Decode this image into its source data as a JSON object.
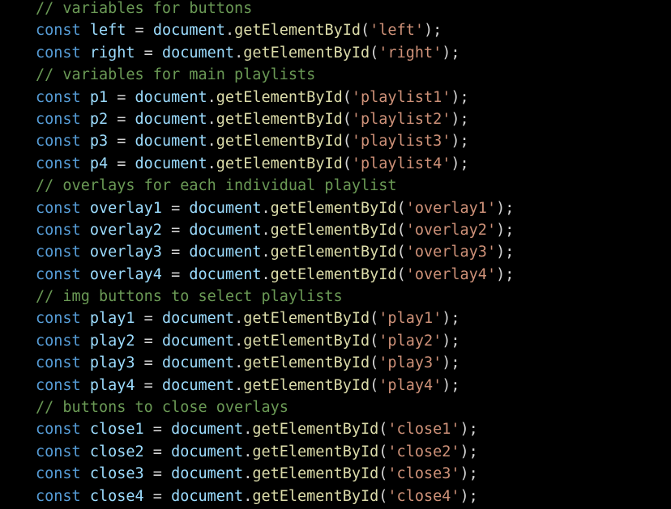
{
  "editor": {
    "lines": [
      {
        "type": "comment",
        "text": "// variables for buttons"
      },
      {
        "type": "code",
        "kw": "const",
        "name": "left",
        "obj": "document",
        "fn": "getElementById",
        "arg": "'left'"
      },
      {
        "type": "code",
        "kw": "const",
        "name": "right",
        "obj": "document",
        "fn": "getElementById",
        "arg": "'right'"
      },
      {
        "type": "comment",
        "text": "// variables for main playlists"
      },
      {
        "type": "code",
        "kw": "const",
        "name": "p1",
        "obj": "document",
        "fn": "getElementById",
        "arg": "'playlist1'"
      },
      {
        "type": "code",
        "kw": "const",
        "name": "p2",
        "obj": "document",
        "fn": "getElementById",
        "arg": "'playlist2'"
      },
      {
        "type": "code",
        "kw": "const",
        "name": "p3",
        "obj": "document",
        "fn": "getElementById",
        "arg": "'playlist3'"
      },
      {
        "type": "code",
        "kw": "const",
        "name": "p4",
        "obj": "document",
        "fn": "getElementById",
        "arg": "'playlist4'"
      },
      {
        "type": "comment",
        "text": "// overlays for each individual playlist"
      },
      {
        "type": "code",
        "kw": "const",
        "name": "overlay1",
        "obj": "document",
        "fn": "getElementById",
        "arg": "'overlay1'"
      },
      {
        "type": "code",
        "kw": "const",
        "name": "overlay2",
        "obj": "document",
        "fn": "getElementById",
        "arg": "'overlay2'"
      },
      {
        "type": "code",
        "kw": "const",
        "name": "overlay3",
        "obj": "document",
        "fn": "getElementById",
        "arg": "'overlay3'"
      },
      {
        "type": "code",
        "kw": "const",
        "name": "overlay4",
        "obj": "document",
        "fn": "getElementById",
        "arg": "'overlay4'"
      },
      {
        "type": "comment",
        "text": "// img buttons to select playlists"
      },
      {
        "type": "code",
        "kw": "const",
        "name": "play1",
        "obj": "document",
        "fn": "getElementById",
        "arg": "'play1'"
      },
      {
        "type": "code",
        "kw": "const",
        "name": "play2",
        "obj": "document",
        "fn": "getElementById",
        "arg": "'play2'"
      },
      {
        "type": "code",
        "kw": "const",
        "name": "play3",
        "obj": "document",
        "fn": "getElementById",
        "arg": "'play3'"
      },
      {
        "type": "code",
        "kw": "const",
        "name": "play4",
        "obj": "document",
        "fn": "getElementById",
        "arg": "'play4'"
      },
      {
        "type": "comment",
        "text": "// buttons to close overlays"
      },
      {
        "type": "code",
        "kw": "const",
        "name": "close1",
        "obj": "document",
        "fn": "getElementById",
        "arg": "'close1'"
      },
      {
        "type": "code",
        "kw": "const",
        "name": "close2",
        "obj": "document",
        "fn": "getElementById",
        "arg": "'close2'"
      },
      {
        "type": "code",
        "kw": "const",
        "name": "close3",
        "obj": "document",
        "fn": "getElementById",
        "arg": "'close3'"
      },
      {
        "type": "code",
        "kw": "const",
        "name": "close4",
        "obj": "document",
        "fn": "getElementById",
        "arg": "'close4'"
      }
    ]
  },
  "colors": {
    "background": "#000000",
    "keyword": "#569cd6",
    "variable": "#9cdcfe",
    "function": "#dcdcaa",
    "string": "#ce9178",
    "punctuation": "#d4d4d4",
    "comment": "#6a9955"
  }
}
